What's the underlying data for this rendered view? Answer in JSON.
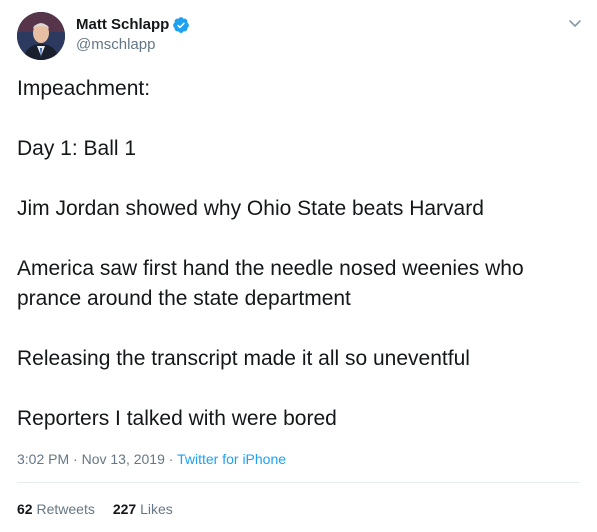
{
  "author": {
    "display_name": "Matt Schlapp",
    "handle": "@mschlapp",
    "verified": true,
    "verified_color": "#1da1f2"
  },
  "tweet": {
    "paragraphs": [
      "Impeachment:",
      "Day 1: Ball 1",
      "Jim Jordan showed why Ohio State beats Harvard",
      "America saw first hand the needle nosed weenies who prance around the state department",
      "Releasing the transcript made it all so uneventful",
      "Reporters I talked with were bored"
    ],
    "time": "3:02 PM",
    "date": "Nov 13, 2019",
    "separator": "·",
    "source": "Twitter for iPhone"
  },
  "stats": {
    "retweets_count": "62",
    "retweets_label": "Retweets",
    "likes_count": "227",
    "likes_label": "Likes"
  },
  "icons": {
    "verified": "verified-badge-icon",
    "menu": "chevron-down-icon"
  },
  "colors": {
    "text": "#14171a",
    "secondary": "#657786",
    "link": "#1da1f2",
    "divider": "#e6ecf0"
  }
}
